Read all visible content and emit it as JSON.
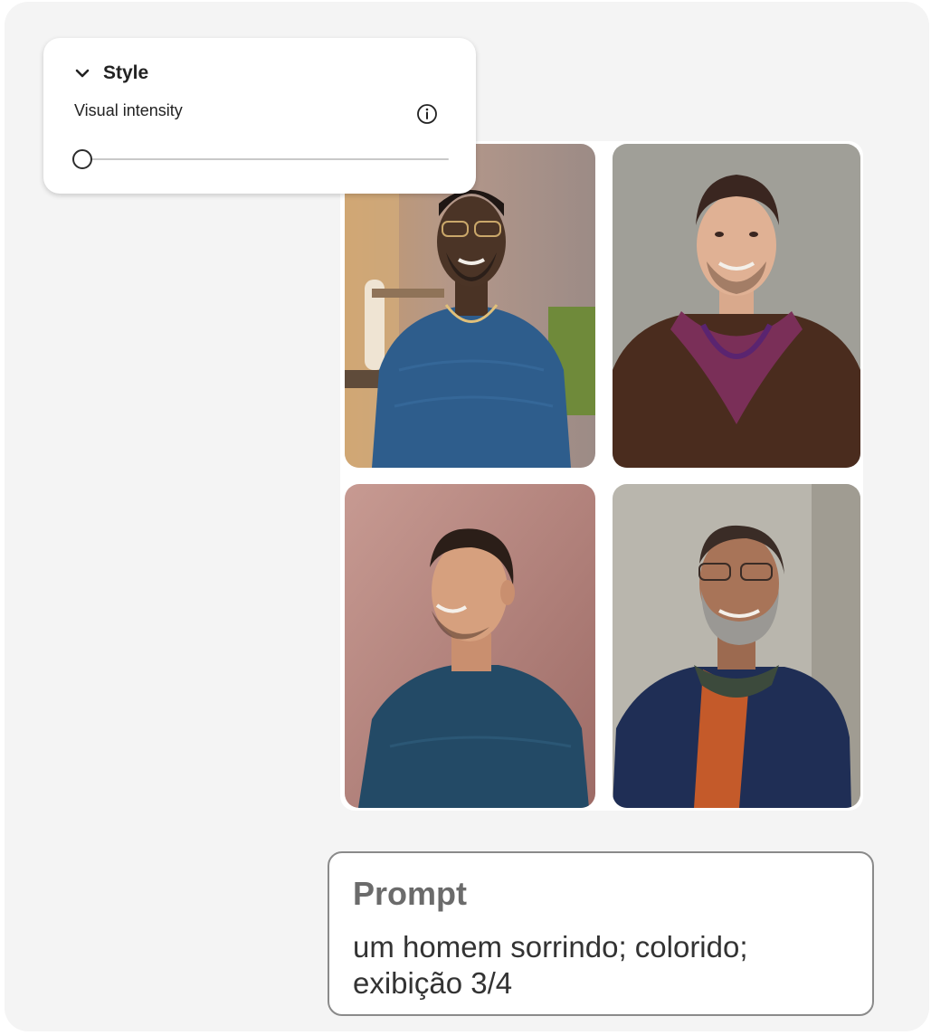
{
  "style_panel": {
    "title": "Style",
    "expanded": true,
    "chevron_icon": "chevron-down-icon",
    "visual_intensity": {
      "label": "Visual intensity",
      "info_icon": "info-icon",
      "value": 0
    }
  },
  "gallery": {
    "images": [
      {
        "icon": "portrait-man-glasses-blue-shirt"
      },
      {
        "icon": "portrait-man-brown-sweater-scarf"
      },
      {
        "icon": "portrait-man-blue-sweater-pink-wall"
      },
      {
        "icon": "portrait-man-gray-beard-glasses"
      }
    ]
  },
  "prompt": {
    "label": "Prompt",
    "text": "um homem sorrindo; colorido; exibição 3/4"
  },
  "colors": {
    "canvas_bg": "#f4f4f4",
    "panel_bg": "#ffffff",
    "border": "#8a8a8a"
  }
}
